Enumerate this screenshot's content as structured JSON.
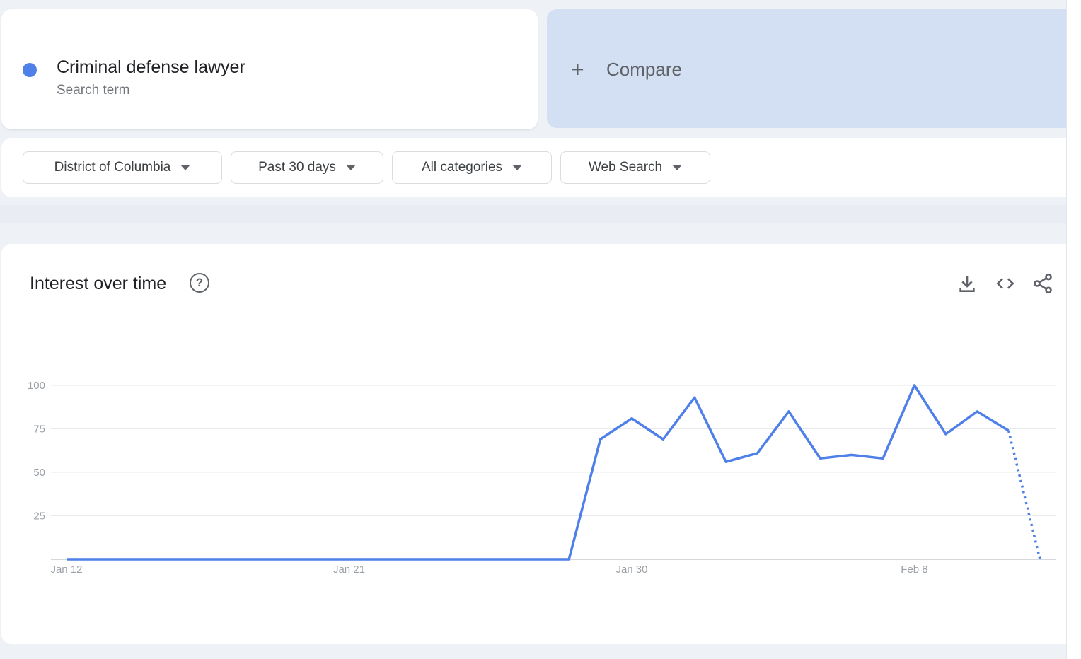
{
  "term": {
    "name": "Criminal defense lawyer",
    "kind": "Search term",
    "color": "#4f7fe8"
  },
  "compare": {
    "icon": "plus-icon",
    "label": "Compare"
  },
  "filters": [
    {
      "label": "District of Columbia"
    },
    {
      "label": "Past 30 days"
    },
    {
      "label": "All categories"
    },
    {
      "label": "Web Search"
    }
  ],
  "panel": {
    "title": "Interest over time",
    "icons": [
      "help-icon",
      "download-icon",
      "embed-code-icon",
      "share-icon"
    ]
  },
  "chart_data": {
    "type": "line",
    "x": [
      "Jan 12",
      "Jan 13",
      "Jan 14",
      "Jan 15",
      "Jan 16",
      "Jan 17",
      "Jan 18",
      "Jan 19",
      "Jan 20",
      "Jan 21",
      "Jan 22",
      "Jan 23",
      "Jan 24",
      "Jan 25",
      "Jan 26",
      "Jan 27",
      "Jan 28",
      "Jan 29",
      "Jan 30",
      "Jan 31",
      "Feb 1",
      "Feb 2",
      "Feb 3",
      "Feb 4",
      "Feb 5",
      "Feb 6",
      "Feb 7",
      "Feb 8",
      "Feb 9",
      "Feb 10",
      "Feb 11",
      "Feb 12"
    ],
    "series": [
      {
        "color": "#4f7fe8",
        "values": [
          0,
          0,
          0,
          0,
          0,
          0,
          0,
          0,
          0,
          0,
          0,
          0,
          0,
          0,
          0,
          0,
          0,
          69,
          81,
          69,
          93,
          56,
          61,
          85,
          58,
          60,
          58,
          100,
          72,
          85,
          74,
          0
        ],
        "partial_from_index": 30
      }
    ],
    "x_ticks": [
      "Jan 12",
      "Jan 21",
      "Jan 30",
      "Feb 8"
    ],
    "y_ticks": [
      100,
      75,
      50,
      25
    ],
    "ylim": [
      0,
      100
    ],
    "grid": true,
    "legend": "none"
  }
}
